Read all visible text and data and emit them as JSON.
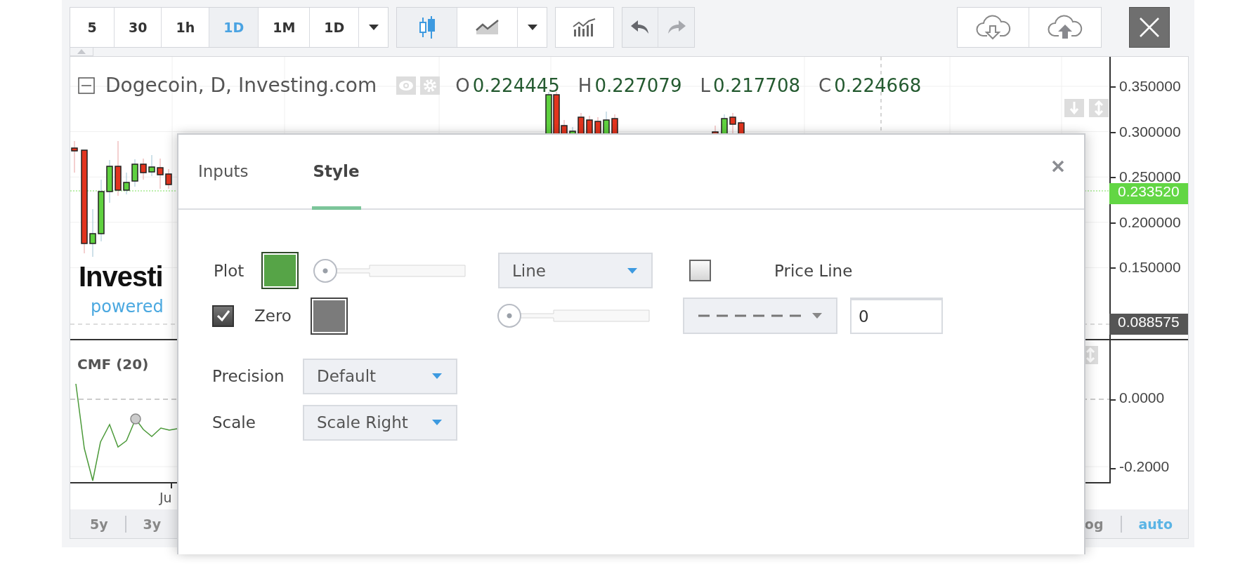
{
  "toolbar": {
    "intervals": [
      {
        "label": "5",
        "selected": false
      },
      {
        "label": "30",
        "selected": false
      },
      {
        "label": "1h",
        "selected": false
      },
      {
        "label": "1D",
        "selected": true
      },
      {
        "label": "1M",
        "selected": false
      },
      {
        "label": "1D",
        "selected": false
      }
    ],
    "chart_types": [
      {
        "kind": "candles",
        "selected": true
      },
      {
        "kind": "area",
        "selected": false
      }
    ],
    "history": [
      {
        "kind": "undo",
        "disabled": false
      },
      {
        "kind": "redo",
        "disabled": true
      }
    ]
  },
  "legend": {
    "title": "Dogecoin, D, Investing.com",
    "values": [
      {
        "key": "O",
        "value": "0.224445"
      },
      {
        "key": "H",
        "value": "0.227079"
      },
      {
        "key": "L",
        "value": "0.217708"
      },
      {
        "key": "C",
        "value": "0.224668"
      }
    ]
  },
  "logo": {
    "name": "Investi",
    "tagline": "powered"
  },
  "price_axis": {
    "ticks": [
      "0.350000",
      "0.300000",
      "0.250000",
      "0.200000",
      "0.150000"
    ],
    "last_price": "0.233520",
    "marker": "0.088575"
  },
  "indicator": {
    "name": "CMF (20)",
    "ticks": [
      "0.0000",
      "-0.2000"
    ]
  },
  "time_axis": {
    "labels": [
      "Ju"
    ]
  },
  "ranges": [
    {
      "label": "5y"
    },
    {
      "label": "3y"
    }
  ],
  "scale_modes": [
    {
      "label": "og",
      "selected": false
    },
    {
      "label": "auto",
      "selected": true
    }
  ],
  "dialog": {
    "tabs": [
      {
        "label": "Inputs",
        "selected": false
      },
      {
        "label": "Style",
        "selected": true
      }
    ],
    "plot": {
      "label": "Plot",
      "color": "#56a447",
      "level": 0,
      "line_type": "Line",
      "price_line": {
        "label": "Price Line",
        "checked": false
      }
    },
    "zero": {
      "label": "Zero",
      "checked": true,
      "color": "#7b7b7b",
      "level": 0,
      "value": "0"
    },
    "precision": {
      "label": "Precision",
      "value": "Default"
    },
    "scale": {
      "label": "Scale",
      "value": "Scale Right"
    }
  }
}
